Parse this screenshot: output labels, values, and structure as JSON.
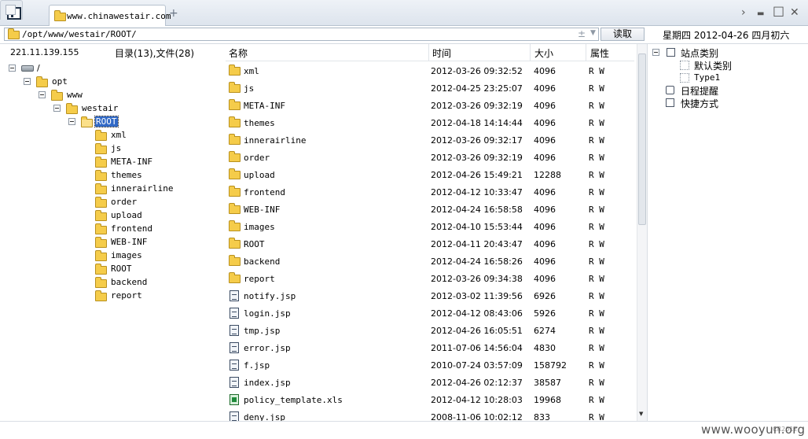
{
  "tabbar": {
    "active_tab_title": "www.chinawestair.com",
    "new_tab": "+",
    "win_next": "›",
    "win_min": "▬",
    "win_max": "□",
    "win_close": "✕"
  },
  "address": {
    "path": "/opt/www/westair/ROOT/",
    "plus": "±",
    "read_button": "读取",
    "datetime": "星期四 2012-04-26 四月初六"
  },
  "left": {
    "ip": "221.11.139.155",
    "counts": "目录(13),文件(28)",
    "tree": {
      "root": "/",
      "opt": "opt",
      "www": "www",
      "westair": "westair",
      "selected": "ROOT",
      "children": [
        "xml",
        "js",
        "META-INF",
        "themes",
        "innerairline",
        "order",
        "upload",
        "frontend",
        "WEB-INF",
        "images",
        "ROOT",
        "backend",
        "report"
      ]
    }
  },
  "list": {
    "headers": {
      "name": "名称",
      "time": "时间",
      "size": "大小",
      "attr": "属性"
    },
    "rows": [
      {
        "name": "xml",
        "time": "2012-03-26 09:32:52",
        "size": "4096",
        "attr": "R W",
        "type": "folder"
      },
      {
        "name": "js",
        "time": "2012-04-25 23:25:07",
        "size": "4096",
        "attr": "R W",
        "type": "folder"
      },
      {
        "name": "META-INF",
        "time": "2012-03-26 09:32:19",
        "size": "4096",
        "attr": "R W",
        "type": "folder"
      },
      {
        "name": "themes",
        "time": "2012-04-18 14:14:44",
        "size": "4096",
        "attr": "R W",
        "type": "folder"
      },
      {
        "name": "innerairline",
        "time": "2012-03-26 09:32:17",
        "size": "4096",
        "attr": "R W",
        "type": "folder"
      },
      {
        "name": "order",
        "time": "2012-03-26 09:32:19",
        "size": "4096",
        "attr": "R W",
        "type": "folder"
      },
      {
        "name": "upload",
        "time": "2012-04-26 15:49:21",
        "size": "12288",
        "attr": "R W",
        "type": "folder"
      },
      {
        "name": "frontend",
        "time": "2012-04-12 10:33:47",
        "size": "4096",
        "attr": "R W",
        "type": "folder"
      },
      {
        "name": "WEB-INF",
        "time": "2012-04-24 16:58:58",
        "size": "4096",
        "attr": "R W",
        "type": "folder"
      },
      {
        "name": "images",
        "time": "2012-04-10 15:53:44",
        "size": "4096",
        "attr": "R W",
        "type": "folder"
      },
      {
        "name": "ROOT",
        "time": "2012-04-11 20:43:47",
        "size": "4096",
        "attr": "R W",
        "type": "folder"
      },
      {
        "name": "backend",
        "time": "2012-04-24 16:58:26",
        "size": "4096",
        "attr": "R W",
        "type": "folder"
      },
      {
        "name": "report",
        "time": "2012-03-26 09:34:38",
        "size": "4096",
        "attr": "R W",
        "type": "folder"
      },
      {
        "name": "notify.jsp",
        "time": "2012-03-02 11:39:56",
        "size": "6926",
        "attr": "R W",
        "type": "file"
      },
      {
        "name": "login.jsp",
        "time": "2012-04-12 08:43:06",
        "size": "5926",
        "attr": "R W",
        "type": "file"
      },
      {
        "name": "tmp.jsp",
        "time": "2012-04-26 16:05:51",
        "size": "6274",
        "attr": "R W",
        "type": "file"
      },
      {
        "name": "error.jsp",
        "time": "2011-07-06 14:56:04",
        "size": "4830",
        "attr": "R W",
        "type": "file"
      },
      {
        "name": "f.jsp",
        "time": "2010-07-24 03:57:09",
        "size": "158792",
        "attr": "R W",
        "type": "file"
      },
      {
        "name": "index.jsp",
        "time": "2012-04-26 02:12:37",
        "size": "38587",
        "attr": "R W",
        "type": "file"
      },
      {
        "name": "policy_template.xls",
        "time": "2012-04-12 10:28:03",
        "size": "19968",
        "attr": "R W",
        "type": "xls"
      },
      {
        "name": "deny.jsp",
        "time": "2008-11-06 10:02:12",
        "size": "833",
        "attr": "R W",
        "type": "file"
      }
    ]
  },
  "right": {
    "site_category": "站点类别",
    "default_category": "默认类别",
    "type1": "Type1",
    "schedule": "日程提醒",
    "shortcuts": "快捷方式"
  },
  "footer": {
    "watermark": "www.wooyun.org",
    "tiny_label": "CR2012"
  },
  "colors": {
    "selection": "#3169c6",
    "folder": "#f5cc4a"
  }
}
